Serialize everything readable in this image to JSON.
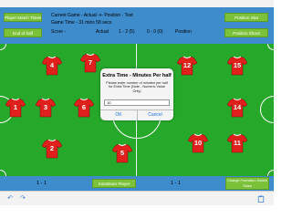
{
  "header": {
    "player_match_times_label": "Player Match Times",
    "end_of_half_label": "End of half",
    "current_game": "Current Game - Actual -v- Position - Test",
    "game_time": "Game Time - 31 mins 58 secs",
    "score_label": "Score -",
    "actual_label": "Actual",
    "actual_score": "1 - 2 (5)",
    "position_score": "0 - 0 (0)",
    "position_label": "Position",
    "position_stat_label": "Position Stat",
    "position_shoot_label": "Position Shoot"
  },
  "players": [
    "4",
    "7",
    "12",
    "15",
    "1",
    "3",
    "6",
    "14",
    "2",
    "5",
    "10",
    "11"
  ],
  "dialog": {
    "title": "Extra Time - Minutes Per half",
    "message": "Please enter number of minutes per half for Extra Time (Note - Numeric Value Only)",
    "input_value": "10",
    "ok_label": "OK",
    "cancel_label": "Cancel"
  },
  "bottom": {
    "left_score": "1 - 1",
    "substitute_label": "Substitute Player",
    "right_score": "1 - 1",
    "change_formation_label": "Change Formation Switch Sides"
  },
  "toolbar": {
    "undo_icon": "undo-icon",
    "redo_icon": "redo-icon",
    "clipboard_icon": "clipboard-icon"
  },
  "colors": {
    "header_blue": "#3f8ccd",
    "pitch_green": "#26a92b",
    "button_green": "#7cc13a",
    "shirt_red": "#e0201c",
    "dialog_link": "#1a73e8"
  }
}
